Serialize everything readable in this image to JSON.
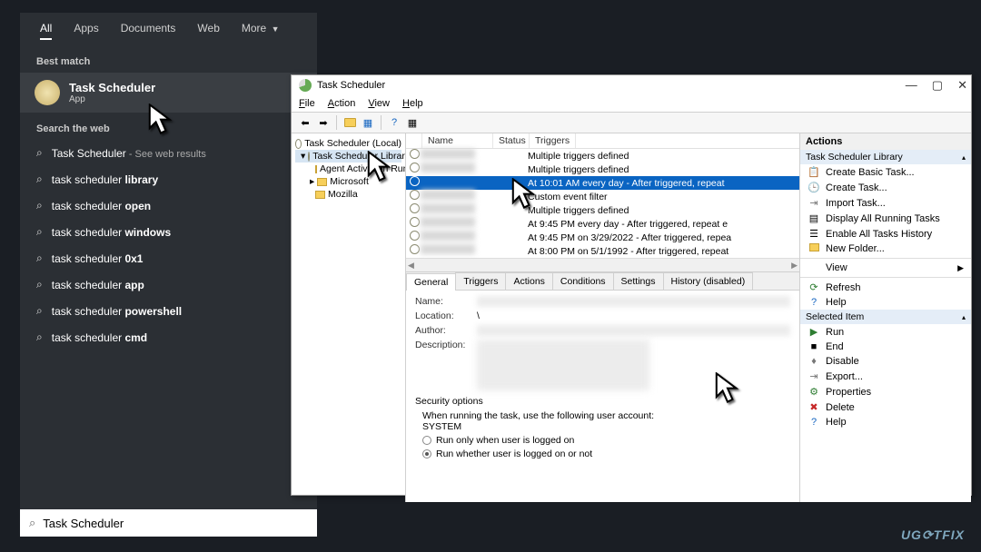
{
  "start": {
    "tabs": [
      "All",
      "Apps",
      "Documents",
      "Web",
      "More"
    ],
    "best_match_label": "Best match",
    "best_match": {
      "title": "Task Scheduler",
      "subtitle": "App"
    },
    "search_web_label": "Search the web",
    "web_results": [
      {
        "prefix": "Task Scheduler",
        "bold": "",
        "hint": " - See web results"
      },
      {
        "prefix": "task scheduler ",
        "bold": "library",
        "hint": ""
      },
      {
        "prefix": "task scheduler ",
        "bold": "open",
        "hint": ""
      },
      {
        "prefix": "task scheduler ",
        "bold": "windows",
        "hint": ""
      },
      {
        "prefix": "task scheduler ",
        "bold": "0x1",
        "hint": ""
      },
      {
        "prefix": "task scheduler ",
        "bold": "app",
        "hint": ""
      },
      {
        "prefix": "task scheduler ",
        "bold": "powershell",
        "hint": ""
      },
      {
        "prefix": "task scheduler ",
        "bold": "cmd",
        "hint": ""
      }
    ],
    "search_value": "Task Scheduler"
  },
  "win": {
    "title": "Task Scheduler",
    "menu": [
      "File",
      "Action",
      "View",
      "Help"
    ],
    "tree": {
      "root": "Task Scheduler (Local)",
      "lib": "Task Scheduler Library",
      "children": [
        "Agent Activation Runt",
        "Microsoft",
        "Mozilla"
      ]
    },
    "tl_cols": [
      "Name",
      "Status",
      "Triggers"
    ],
    "tasks": [
      {
        "trigger": "Multiple triggers defined",
        "sel": false
      },
      {
        "trigger": "Multiple triggers defined",
        "sel": false
      },
      {
        "trigger": "At 10:01 AM every day - After triggered, repeat",
        "sel": true
      },
      {
        "trigger": "Custom event filter",
        "sel": false
      },
      {
        "trigger": "Multiple triggers defined",
        "sel": false
      },
      {
        "trigger": "At 9:45 PM every day - After triggered, repeat e",
        "sel": false
      },
      {
        "trigger": "At 9:45 PM on 3/29/2022 - After triggered, repea",
        "sel": false
      },
      {
        "trigger": "At 8:00 PM on 5/1/1992 - After triggered, repeat",
        "sel": false
      }
    ],
    "detail_tabs": [
      "General",
      "Triggers",
      "Actions",
      "Conditions",
      "Settings",
      "History (disabled)"
    ],
    "general": {
      "name_lbl": "Name:",
      "loc_lbl": "Location:",
      "loc_val": "\\",
      "author_lbl": "Author:",
      "desc_lbl": "Description:",
      "sec_lbl": "Security options",
      "sec_line": "When running the task, use the following user account:",
      "sec_user": "SYSTEM",
      "opt1": "Run only when user is logged on",
      "opt2": "Run whether user is logged on or not"
    },
    "actions": {
      "title": "Actions",
      "lib": "Task Scheduler Library",
      "lib_items": [
        "Create Basic Task...",
        "Create Task...",
        "Import Task...",
        "Display All Running Tasks",
        "Enable All Tasks History",
        "New Folder..."
      ],
      "view": "View",
      "refresh": "Refresh",
      "help1": "Help",
      "sel_head": "Selected Item",
      "sel_items": [
        "Run",
        "End",
        "Disable",
        "Export...",
        "Properties",
        "Delete",
        "Help"
      ]
    }
  },
  "watermark": "UG⟳TFIX"
}
